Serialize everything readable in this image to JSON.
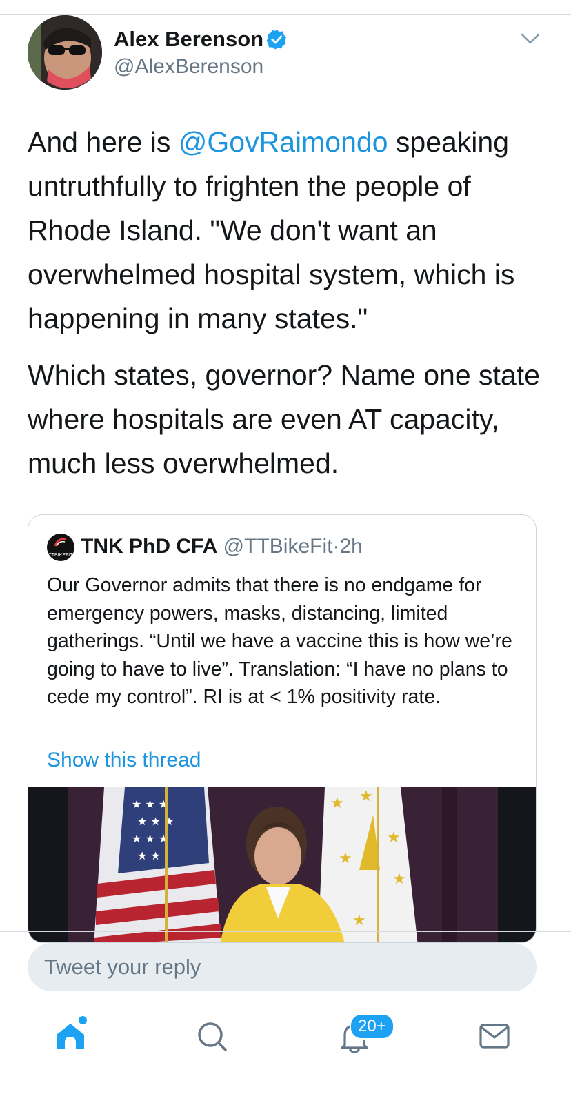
{
  "tweet": {
    "author_name": "Alex Berenson",
    "author_handle": "@AlexBerenson",
    "text_p1_before": "And here is ",
    "text_p1_mention": "@GovRaimondo",
    "text_p1_after": " speaking untruthfully to frighten the people of Rhode Island. \"We don't want an overwhelmed hospital system, which is happening in many states.\"",
    "text_p2": "Which states, governor? Name one state where hospitals are even AT capacity, much less overwhelmed."
  },
  "quote": {
    "author_name": "TNK PhD CFA",
    "author_handle": "@TTBikeFit",
    "separator": "·",
    "time": "2h",
    "avatar_text": "TTBIKEFIT",
    "text": "Our Governor admits that there is no endgame for emergency powers, masks, distancing, limited gatherings. “Until we have a vaccine this is how we’re going to have to live”. Translation: “I have no plans to cede my control”. RI is at < 1% positivity rate.",
    "show_thread": "Show this thread"
  },
  "reply": {
    "placeholder": "Tweet your reply"
  },
  "nav": {
    "notifications_badge": "20+"
  },
  "colors": {
    "accent": "#1da1f2",
    "link": "#1b95e0",
    "secondary_text": "#657786",
    "reply_bg": "#e6ecf0"
  },
  "icons": [
    "verified-badge-icon",
    "chevron-down-icon",
    "home-icon",
    "search-icon",
    "notifications-bell-icon",
    "messages-envelope-icon"
  ]
}
